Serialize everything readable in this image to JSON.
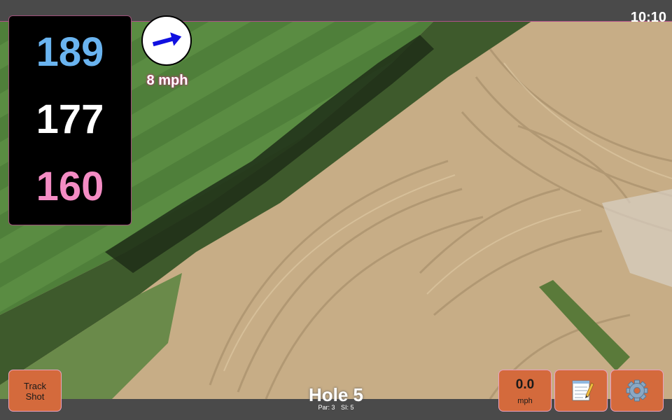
{
  "status": {
    "time": "10:10"
  },
  "distances": {
    "back": "189",
    "center": "177",
    "front": "160"
  },
  "wind": {
    "speed_label": "8 mph",
    "direction_degrees": -15,
    "icon": "wind-arrow-icon"
  },
  "hole": {
    "title": "Hole 5",
    "par_label": "Par: 3",
    "si_label": "SI: 5"
  },
  "buttons": {
    "track_shot_line1": "Track",
    "track_shot_line2": "Shot",
    "speed_value": "0.0",
    "speed_unit": "mph",
    "notes_icon": "notepad-icon",
    "settings_icon": "gear-icon"
  },
  "colors": {
    "back": "#6ab4f0",
    "center": "#ffffff",
    "front": "#f48cc4",
    "button": "#d46a3c",
    "arrow": "#1010e0"
  }
}
